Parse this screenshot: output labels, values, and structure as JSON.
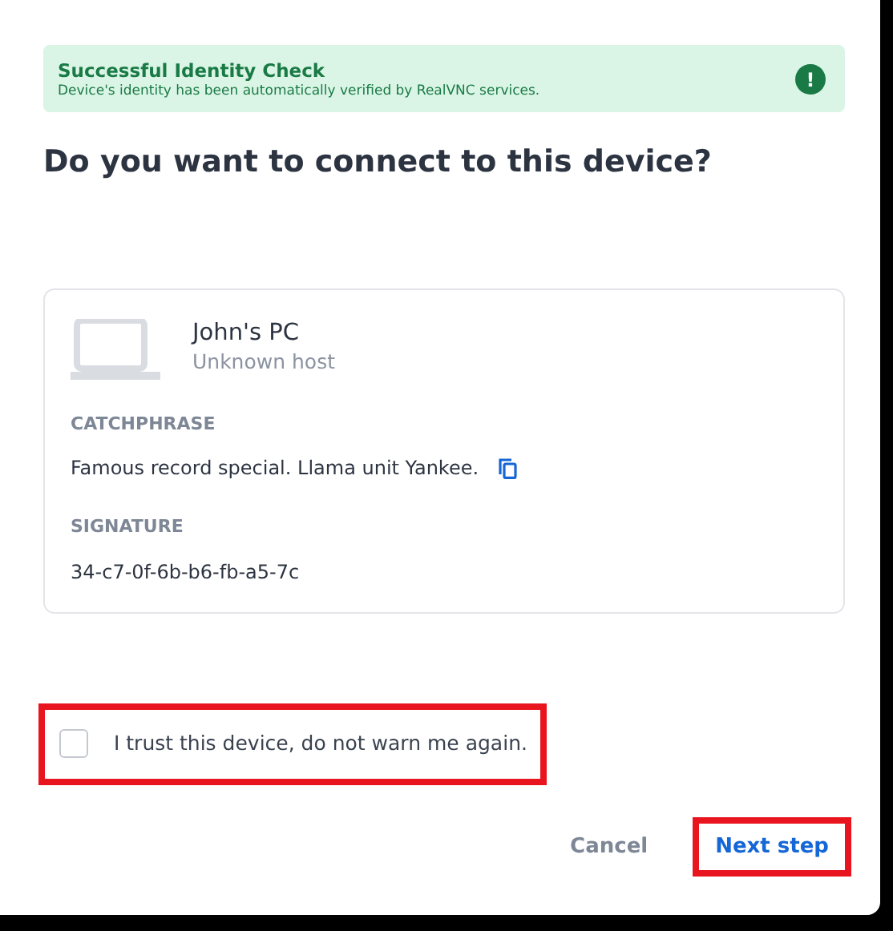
{
  "alert": {
    "title": "Successful Identity Check",
    "message": "Device's identity has been automatically verified by RealVNC services.",
    "icon": "!"
  },
  "heading": "Do you want to connect to this device?",
  "device": {
    "name": "John's PC",
    "subtitle": "Unknown host",
    "fields": [
      {
        "label": "CATCHPHRASE",
        "value": "Famous record special. Llama unit Yankee.",
        "copyable": true
      },
      {
        "label": "SIGNATURE",
        "value": "34-c7-0f-6b-b6-fb-a5-7c",
        "copyable": false
      }
    ]
  },
  "trust": {
    "label": "I trust this device, do not warn me again.",
    "checked": false,
    "highlighted": true
  },
  "buttons": [
    {
      "label": "Cancel",
      "kind": "secondary",
      "highlighted": false
    },
    {
      "label": "Next step",
      "kind": "primary",
      "highlighted": true
    }
  ]
}
